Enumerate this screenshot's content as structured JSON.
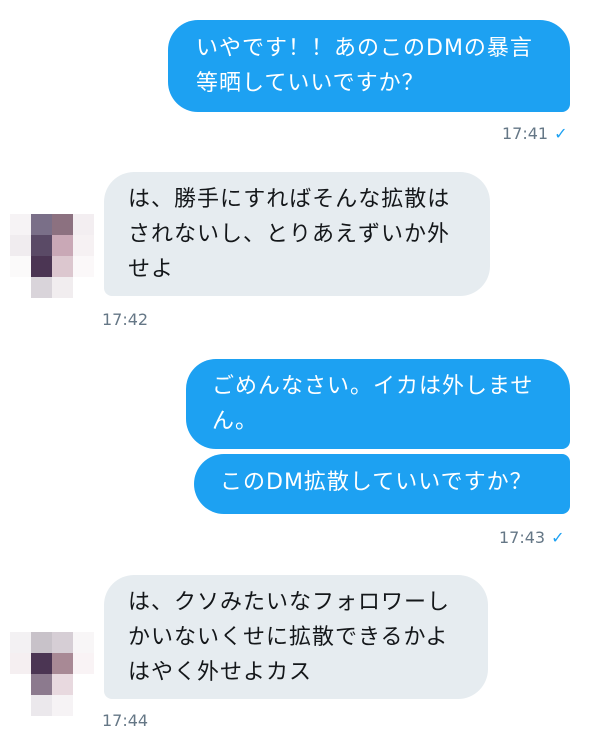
{
  "messages": [
    {
      "text": "いやです！！あのこのDMの暴言等晒していいですか？",
      "time": "17:41"
    },
    {
      "text": "は、勝手にすればそんな拡散はされないし、とりあえずいか外せよ",
      "time": "17:42"
    },
    {
      "text": "ごめんなさい。イカは外しません。"
    },
    {
      "text": "このDM拡散していいですか？",
      "time": "17:43"
    },
    {
      "text": "は、クソみたいなフォロワーしかいないくせに拡散できるかよはやく外せよカス",
      "time": "17:44"
    }
  ],
  "read_mark": "✓",
  "colors": {
    "sent_bubble": "#1da1f2",
    "received_bubble": "#e6ecf0",
    "timestamp": "#657786"
  }
}
